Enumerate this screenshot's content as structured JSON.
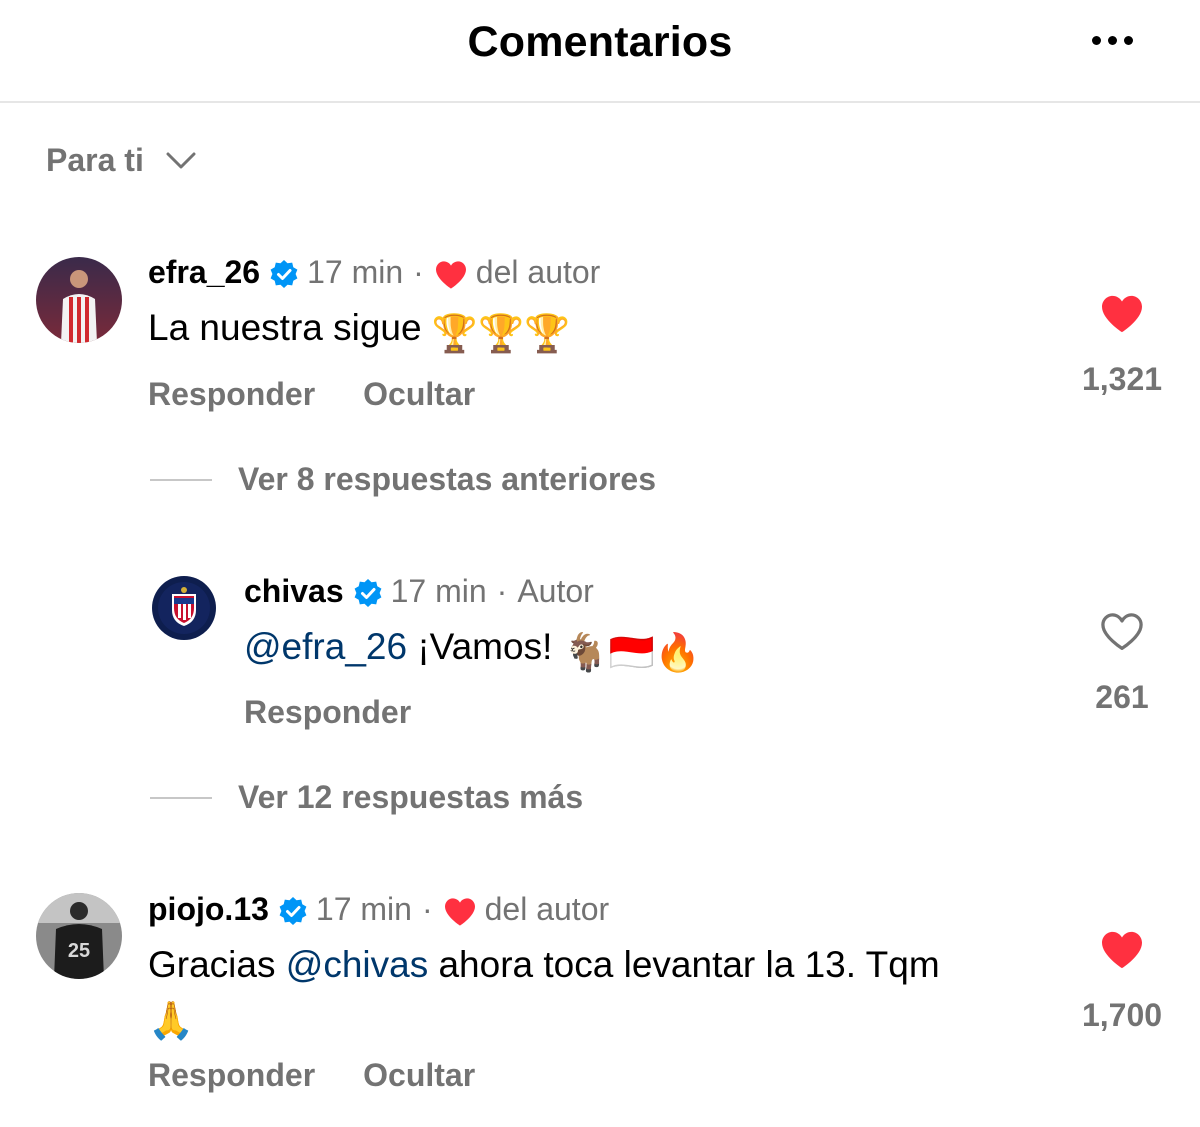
{
  "header": {
    "title": "Comentarios",
    "more_icon": "more-horizontal-icon"
  },
  "sort": {
    "label": "Para ti",
    "icon": "chevron-down-icon"
  },
  "colors": {
    "like_red": "#ff3040",
    "verified_blue": "#0095f6",
    "mention": "#00376b",
    "secondary": "#737373"
  },
  "comments": [
    {
      "username": "efra_26",
      "verified": true,
      "time": "17 min",
      "author_like": "del autor",
      "text": "La nuestra sigue",
      "emojis": "🏆🏆🏆",
      "actions": [
        "Responder",
        "Ocultar"
      ],
      "likes": "1,321",
      "liked": true
    },
    {
      "username": "chivas",
      "verified": true,
      "time": "17 min",
      "author_tag": "Autor",
      "mention": "@efra_26",
      "text": "¡Vamos!",
      "emojis": "🐐🇮🇩🔥",
      "actions": [
        "Responder"
      ],
      "likes": "261",
      "liked": false
    },
    {
      "username": "piojo.13",
      "verified": true,
      "time": "17 min",
      "author_like": "del autor",
      "text_before": "Gracias",
      "mention": "@chivas",
      "text_after": "ahora toca levantar la 13. Tqm",
      "emojis": "🙏",
      "actions": [
        "Responder",
        "Ocultar"
      ],
      "likes": "1,700",
      "liked": true
    }
  ],
  "view_more": {
    "previous": "Ver 8 respuestas anteriores",
    "more": "Ver 12 respuestas más"
  }
}
